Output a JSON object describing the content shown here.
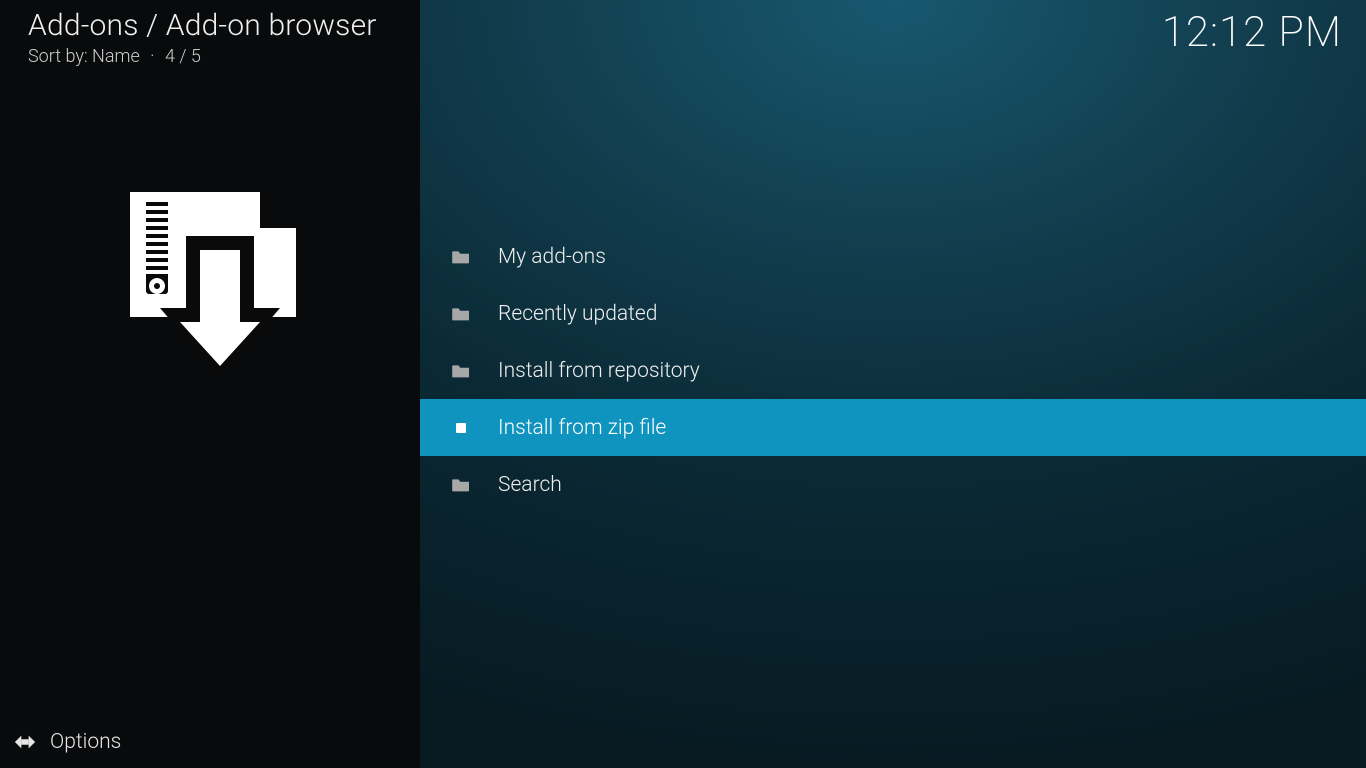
{
  "header": {
    "breadcrumb": "Add-ons / Add-on browser",
    "sort_label": "Sort by: Name",
    "position": "4 / 5"
  },
  "clock": "12:12 PM",
  "sidebar": {
    "options_label": "Options"
  },
  "list": {
    "items": [
      {
        "label": "My add-ons",
        "icon": "folder",
        "selected": false
      },
      {
        "label": "Recently updated",
        "icon": "folder",
        "selected": false
      },
      {
        "label": "Install from repository",
        "icon": "folder",
        "selected": false
      },
      {
        "label": "Install from zip file",
        "icon": "zip",
        "selected": true
      },
      {
        "label": "Search",
        "icon": "folder",
        "selected": false
      }
    ]
  }
}
